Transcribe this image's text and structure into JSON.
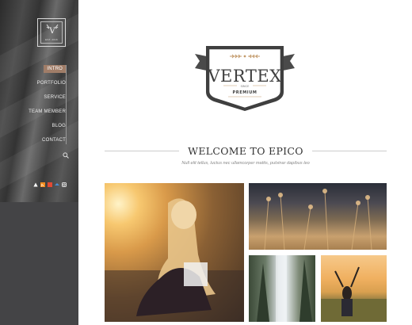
{
  "sidebar": {
    "logo": {
      "letter": "V",
      "est": "EST. 2016"
    },
    "menu": [
      {
        "label": "INTRO",
        "active": true
      },
      {
        "label": "PORTFOLIO",
        "active": false
      },
      {
        "label": "SERVICE",
        "active": false
      },
      {
        "label": "TEAM MEMBER",
        "active": false
      },
      {
        "label": "BLOG",
        "active": false
      },
      {
        "label": "CONTACT",
        "active": false
      }
    ],
    "search_icon": "search-icon",
    "social_icons": [
      {
        "name": "social-icon-1",
        "color": "#ffffff"
      },
      {
        "name": "rss-icon",
        "color": "#f28c1e"
      },
      {
        "name": "social-icon-3",
        "color": "#e24a34"
      },
      {
        "name": "social-icon-4",
        "color": "#4a8fd6"
      },
      {
        "name": "instagram-icon",
        "color": "#ffffff"
      }
    ]
  },
  "brand": {
    "name": "VERTEX",
    "small_text": "SINCE",
    "sub": "PREMIUM"
  },
  "welcome": {
    "title": "WELCOME TO EPICO",
    "tagline": "Null elit tellus, luctus nec ullamcorper mattis, pulvinar dapibus leo"
  },
  "colors": {
    "accent": "#a07d68",
    "sidebar_dark": "#444446"
  }
}
